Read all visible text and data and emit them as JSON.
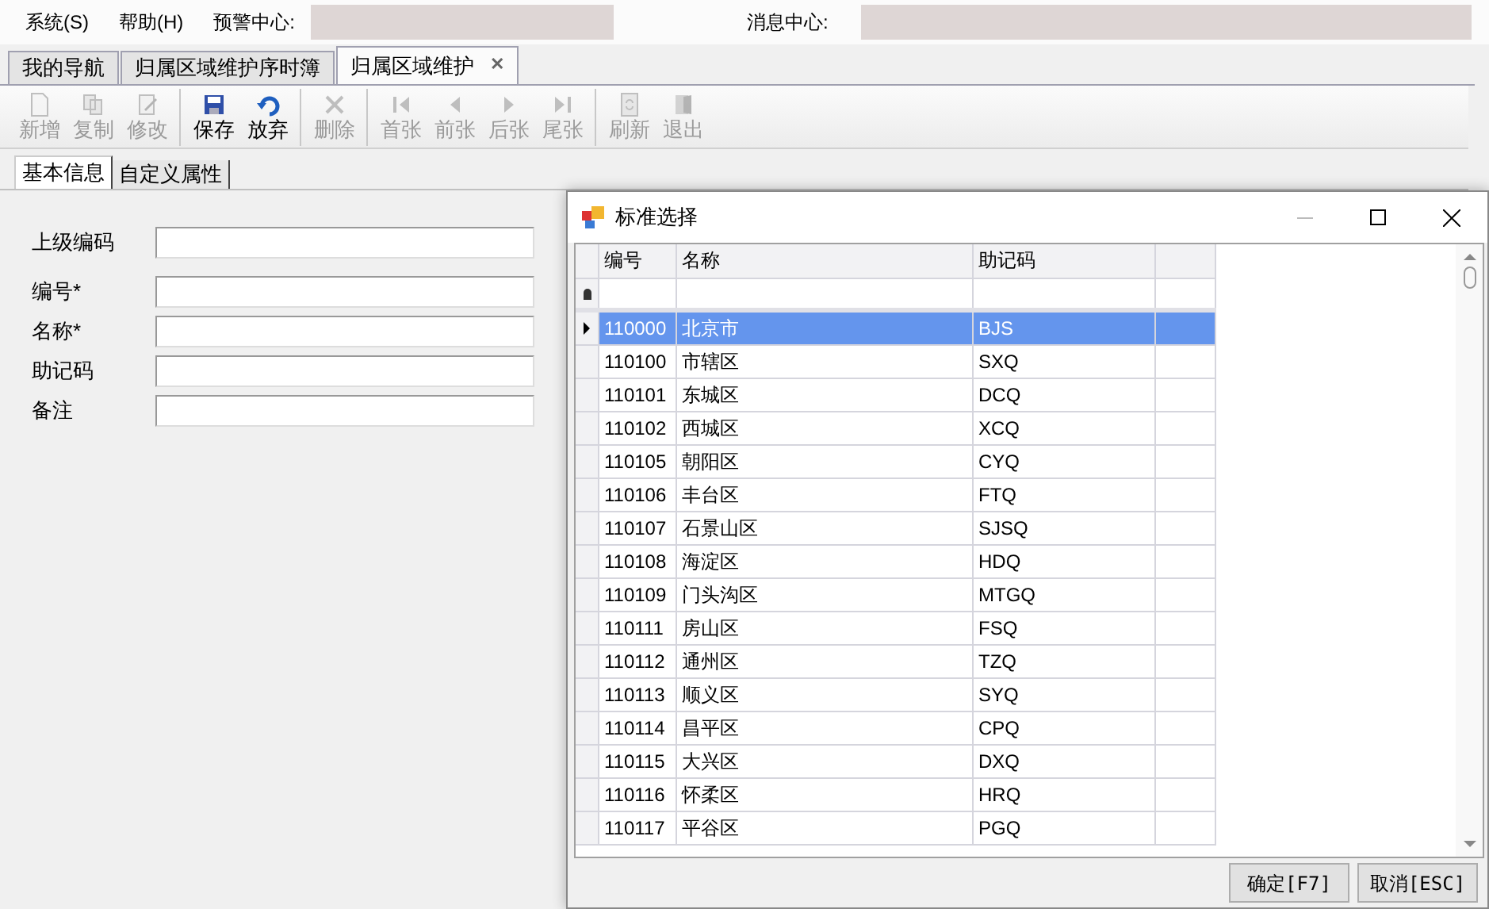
{
  "menu": [
    {
      "label": "系统(S)"
    },
    {
      "label": "帮助(H)"
    }
  ],
  "alert_center": {
    "label": "预警中心:"
  },
  "message_center": {
    "label": "消息中心:"
  },
  "tabs": [
    {
      "label": "我的导航",
      "selected": false
    },
    {
      "label": "归属区域维护序时簿",
      "selected": false
    },
    {
      "label": "归属区域维护",
      "selected": true,
      "close": "✕"
    }
  ],
  "toolbar": [
    {
      "label": "新增",
      "kind": "new",
      "disabled": true,
      "group_end": false
    },
    {
      "label": "复制",
      "kind": "copy",
      "disabled": true,
      "group_end": false
    },
    {
      "label": "修改",
      "kind": "edit",
      "disabled": true,
      "group_end": true
    },
    {
      "label": "保存",
      "kind": "save",
      "disabled": false,
      "group_end": false
    },
    {
      "label": "放弃",
      "kind": "undo",
      "disabled": false,
      "group_end": true
    },
    {
      "label": "删除",
      "kind": "delete",
      "disabled": true,
      "group_end": true
    },
    {
      "label": "首张",
      "kind": "first",
      "disabled": true,
      "group_end": false
    },
    {
      "label": "前张",
      "kind": "prev",
      "disabled": true,
      "group_end": false
    },
    {
      "label": "后张",
      "kind": "next",
      "disabled": true,
      "group_end": false
    },
    {
      "label": "尾张",
      "kind": "last",
      "disabled": true,
      "group_end": true
    },
    {
      "label": "刷新",
      "kind": "refresh",
      "disabled": true,
      "group_end": false
    },
    {
      "label": "退出",
      "kind": "exit",
      "disabled": true,
      "group_end": false
    }
  ],
  "sub_tabs": [
    {
      "label": "基本信息",
      "selected": true
    },
    {
      "label": "自定义属性",
      "selected": false
    }
  ],
  "form": [
    {
      "label": "上级编码"
    },
    {
      "label": "编号*"
    },
    {
      "label": "名称*"
    },
    {
      "label": "助记码"
    },
    {
      "label": "备注"
    }
  ],
  "dialog": {
    "title": "标准选择",
    "columns": [
      "编号",
      "名称",
      "助记码"
    ],
    "rows": [
      {
        "code": "110000",
        "name": "北京市",
        "mnemonic": "BJS",
        "selected": true
      },
      {
        "code": "110100",
        "name": "市辖区",
        "mnemonic": "SXQ",
        "selected": false
      },
      {
        "code": "110101",
        "name": "东城区",
        "mnemonic": "DCQ",
        "selected": false
      },
      {
        "code": "110102",
        "name": "西城区",
        "mnemonic": "XCQ",
        "selected": false
      },
      {
        "code": "110105",
        "name": "朝阳区",
        "mnemonic": "CYQ",
        "selected": false
      },
      {
        "code": "110106",
        "name": "丰台区",
        "mnemonic": "FTQ",
        "selected": false
      },
      {
        "code": "110107",
        "name": "石景山区",
        "mnemonic": "SJSQ",
        "selected": false
      },
      {
        "code": "110108",
        "name": "海淀区",
        "mnemonic": "HDQ",
        "selected": false
      },
      {
        "code": "110109",
        "name": "门头沟区",
        "mnemonic": "MTGQ",
        "selected": false
      },
      {
        "code": "110111",
        "name": "房山区",
        "mnemonic": "FSQ",
        "selected": false
      },
      {
        "code": "110112",
        "name": "通州区",
        "mnemonic": "TZQ",
        "selected": false
      },
      {
        "code": "110113",
        "name": "顺义区",
        "mnemonic": "SYQ",
        "selected": false
      },
      {
        "code": "110114",
        "name": "昌平区",
        "mnemonic": "CPQ",
        "selected": false
      },
      {
        "code": "110115",
        "name": "大兴区",
        "mnemonic": "DXQ",
        "selected": false
      },
      {
        "code": "110116",
        "name": "怀柔区",
        "mnemonic": "HRQ",
        "selected": false
      },
      {
        "code": "110117",
        "name": "平谷区",
        "mnemonic": "PGQ",
        "selected": false
      }
    ],
    "buttons": [
      {
        "label": "确定[F7]"
      },
      {
        "label": "取消[ESC]"
      }
    ]
  }
}
